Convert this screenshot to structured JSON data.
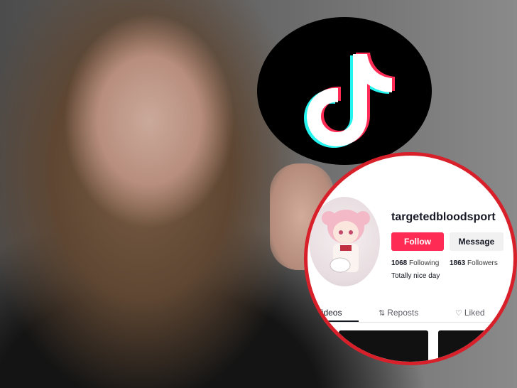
{
  "profile": {
    "username": "targetedbloodsport",
    "follow_label": "Follow",
    "message_label": "Message",
    "following_count": "1068",
    "following_label": "Following",
    "followers_count": "1863",
    "followers_label": "Followers",
    "bio": "Totally nice day"
  },
  "tabs": [
    {
      "label": "Videos",
      "icon": ""
    },
    {
      "label": "Reposts",
      "icon": "repost-icon"
    },
    {
      "label": "Liked",
      "icon": "heart-lock-icon"
    }
  ],
  "colors": {
    "follow_button": "#fe2c55",
    "highlight_ring": "#d8202a",
    "tiktok_cyan": "#25f4ee",
    "tiktok_red": "#fe2c55"
  },
  "icons": {
    "logo": "tiktok-logo-icon"
  }
}
